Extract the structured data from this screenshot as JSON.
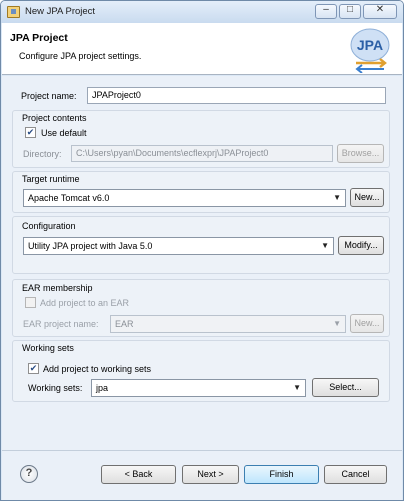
{
  "window": {
    "title": "New JPA Project",
    "controls": {
      "minimize": "▭",
      "maximize": "▢",
      "close": "✕"
    }
  },
  "header": {
    "title": "JPA Project",
    "description": "Configure JPA project settings.",
    "logo_text": "JPA"
  },
  "project_name": {
    "label": "Project name:",
    "value": "JPAProject0"
  },
  "project_contents": {
    "title": "Project contents",
    "use_default_label": "Use default",
    "use_default_checked": true,
    "directory_label": "Directory:",
    "directory_value": "C:\\Users\\pyan\\Documents\\ecflexprj\\JPAProject0",
    "browse_label": "Browse..."
  },
  "target_runtime": {
    "title": "Target runtime",
    "value": "Apache Tomcat v6.0",
    "new_label": "New..."
  },
  "configuration": {
    "title": "Configuration",
    "value": "Utility JPA project with Java 5.0",
    "modify_label": "Modify..."
  },
  "ear": {
    "title": "EAR membership",
    "add_label": "Add project to an EAR",
    "add_checked": false,
    "name_label": "EAR project name:",
    "name_value": "EAR",
    "new_label": "New..."
  },
  "working_sets": {
    "title": "Working sets",
    "add_label": "Add project to working sets",
    "add_checked": true,
    "sets_label": "Working sets:",
    "sets_value": "jpa",
    "select_label": "Select..."
  },
  "footer": {
    "help": "?",
    "back_label": "< Back",
    "next_label": "Next >",
    "finish_label": "Finish",
    "cancel_label": "Cancel"
  }
}
